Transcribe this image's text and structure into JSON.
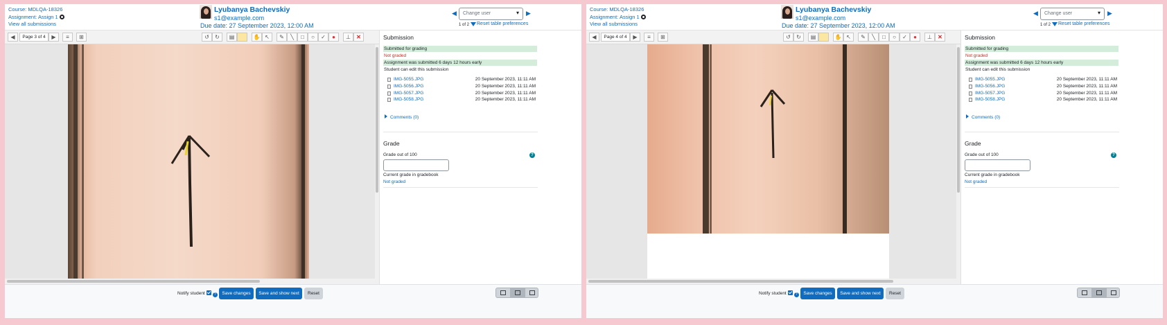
{
  "header": {
    "course": "Course: MDLQA-18326",
    "assignment": "Assignment: Assign 1",
    "view_all": "View all submissions",
    "user_name": "Lyubanya Bachevskiy",
    "user_email": "s1@example.com",
    "due_date": "Due date: 27 September 2023, 12:00 AM",
    "change_user_placeholder": "Change user",
    "count": "1 of 2",
    "reset_prefs": "Reset table preferences"
  },
  "left_toolbar": {
    "page_label": "Page 3 of 4"
  },
  "right_toolbar": {
    "page_label": "Page 4 of 4"
  },
  "submission": {
    "title": "Submission",
    "status_submitted": "Submitted for grading",
    "status_grade": "Not graded",
    "status_early": "Assignment was submitted 6 days 12 hours early",
    "status_edit": "Student can edit this submission",
    "files": [
      {
        "name": "IMG-5055.JPG",
        "date": "20 September 2023, 11:11 AM"
      },
      {
        "name": "IMG-5056.JPG",
        "date": "20 September 2023, 11:11 AM"
      },
      {
        "name": "IMG-5057.JPG",
        "date": "20 September 2023, 11:11 AM"
      },
      {
        "name": "IMG-5058.JPG",
        "date": "20 September 2023, 11:11 AM"
      }
    ],
    "comments": "Comments (0)"
  },
  "grade": {
    "title": "Grade",
    "out_of": "Grade out of 100",
    "current": "Current grade in gradebook",
    "not_graded": "Not graded"
  },
  "footer": {
    "notify": "Notify student",
    "save": "Save changes",
    "save_next": "Save and show next",
    "reset": "Reset"
  },
  "colors": {
    "link": "#0f6cbf",
    "status_green": "#d4edda",
    "status_red": "#ca3120",
    "delete_red": "#e02020"
  }
}
